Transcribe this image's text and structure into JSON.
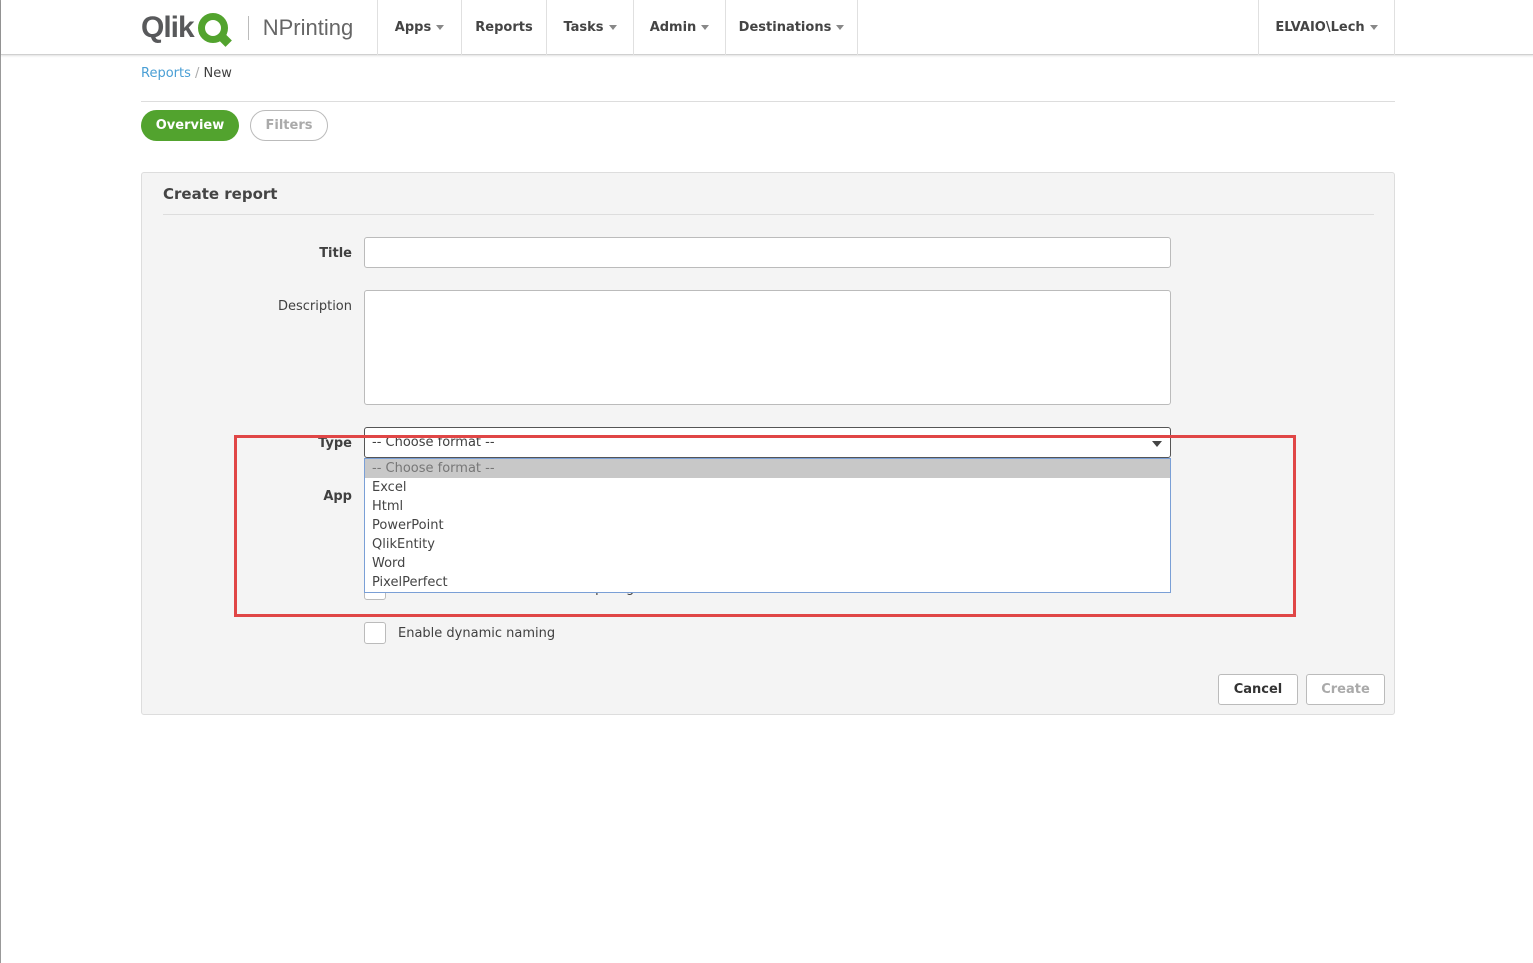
{
  "header": {
    "brand": "Qlik",
    "product": "NPrinting",
    "nav": [
      {
        "label": "Apps",
        "dropdown": true
      },
      {
        "label": "Reports",
        "dropdown": false
      },
      {
        "label": "Tasks",
        "dropdown": true
      },
      {
        "label": "Admin",
        "dropdown": true
      },
      {
        "label": "Destinations",
        "dropdown": true
      }
    ],
    "user": "ELVAIO\\Lech"
  },
  "breadcrumb": {
    "parent": "Reports",
    "separator": "/",
    "current": "New"
  },
  "tabs": [
    {
      "label": "Overview",
      "active": true
    },
    {
      "label": "Filters",
      "active": false
    }
  ],
  "form": {
    "title": "Create report",
    "fields": {
      "title_label": "Title",
      "title_value": "",
      "description_label": "Description",
      "description_value": "",
      "type_label": "Type",
      "type_value": "-- Choose format --",
      "app_label": "App"
    },
    "type_options": [
      "-- Choose format --",
      "Excel",
      "Html",
      "PowerPoint",
      "QlikEntity",
      "Word",
      "PixelPerfect"
    ],
    "checkbox_ondemand": "Enable On-Demand and API report generation",
    "checkbox_dynamic": "Enable dynamic naming",
    "cancel": "Cancel",
    "create": "Create"
  },
  "colors": {
    "accent": "#52a32e",
    "link": "#4a9fd5",
    "highlight": "#e04646"
  }
}
